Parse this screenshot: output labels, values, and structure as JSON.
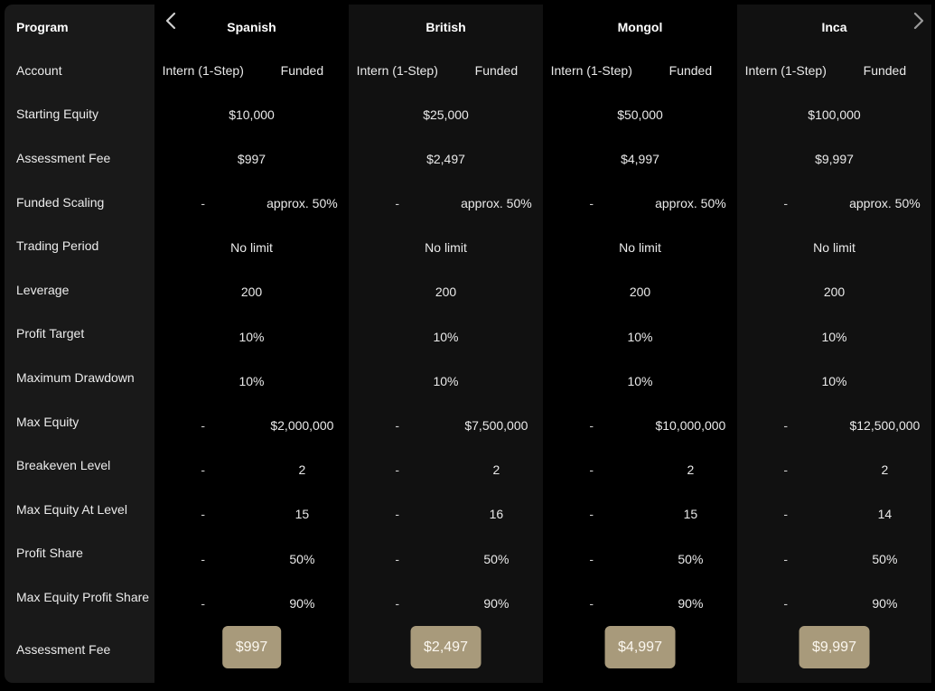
{
  "labels": {
    "program": "Program",
    "account": "Account",
    "starting_equity": "Starting Equity",
    "assessment_fee": "Assessment Fee",
    "funded_scaling": "Funded Scaling",
    "trading_period": "Trading Period",
    "leverage": "Leverage",
    "profit_target": "Profit Target",
    "maximum_drawdown": "Maximum Drawdown",
    "max_equity": "Max Equity",
    "breakeven_level": "Breakeven Level",
    "max_equity_at_level": "Max Equity At Level",
    "profit_share": "Profit Share",
    "max_equity_profit_share": "Max Equity Profit Share",
    "assessment_fee_bottom": "Assessment Fee"
  },
  "nav": {
    "prev_icon": "chevron-left-icon",
    "next_icon": "chevron-right-icon"
  },
  "programs": [
    {
      "name": "Spanish",
      "account_intern": "Intern (1-Step)",
      "account_funded": "Funded",
      "starting_equity": "$10,000",
      "assessment_fee": "$997",
      "funded_scaling_intern": "-",
      "funded_scaling_funded": "approx. 50%",
      "trading_period": "No limit",
      "leverage": "200",
      "profit_target": "10%",
      "maximum_drawdown": "10%",
      "max_equity_intern": "-",
      "max_equity_funded": "$2,000,000",
      "breakeven_intern": "-",
      "breakeven_funded": "2",
      "max_equity_level_intern": "-",
      "max_equity_level_funded": "15",
      "profit_share_intern": "-",
      "profit_share_funded": "50%",
      "max_equity_profit_share_intern": "-",
      "max_equity_profit_share_funded": "90%",
      "button_label": "$997"
    },
    {
      "name": "British",
      "account_intern": "Intern (1-Step)",
      "account_funded": "Funded",
      "starting_equity": "$25,000",
      "assessment_fee": "$2,497",
      "funded_scaling_intern": "-",
      "funded_scaling_funded": "approx. 50%",
      "trading_period": "No limit",
      "leverage": "200",
      "profit_target": "10%",
      "maximum_drawdown": "10%",
      "max_equity_intern": "-",
      "max_equity_funded": "$7,500,000",
      "breakeven_intern": "-",
      "breakeven_funded": "2",
      "max_equity_level_intern": "-",
      "max_equity_level_funded": "16",
      "profit_share_intern": "-",
      "profit_share_funded": "50%",
      "max_equity_profit_share_intern": "-",
      "max_equity_profit_share_funded": "90%",
      "button_label": "$2,497"
    },
    {
      "name": "Mongol",
      "account_intern": "Intern (1-Step)",
      "account_funded": "Funded",
      "starting_equity": "$50,000",
      "assessment_fee": "$4,997",
      "funded_scaling_intern": "-",
      "funded_scaling_funded": "approx. 50%",
      "trading_period": "No limit",
      "leverage": "200",
      "profit_target": "10%",
      "maximum_drawdown": "10%",
      "max_equity_intern": "-",
      "max_equity_funded": "$10,000,000",
      "breakeven_intern": "-",
      "breakeven_funded": "2",
      "max_equity_level_intern": "-",
      "max_equity_level_funded": "15",
      "profit_share_intern": "-",
      "profit_share_funded": "50%",
      "max_equity_profit_share_intern": "-",
      "max_equity_profit_share_funded": "90%",
      "button_label": "$4,997"
    },
    {
      "name": "Inca",
      "account_intern": "Intern (1-Step)",
      "account_funded": "Funded",
      "starting_equity": "$100,000",
      "assessment_fee": "$9,997",
      "funded_scaling_intern": "-",
      "funded_scaling_funded": "approx. 50%",
      "trading_period": "No limit",
      "leverage": "200",
      "profit_target": "10%",
      "maximum_drawdown": "10%",
      "max_equity_intern": "-",
      "max_equity_funded": "$12,500,000",
      "breakeven_intern": "-",
      "breakeven_funded": "2",
      "max_equity_level_intern": "-",
      "max_equity_level_funded": "14",
      "profit_share_intern": "-",
      "profit_share_funded": "50%",
      "max_equity_profit_share_intern": "-",
      "max_equity_profit_share_funded": "90%",
      "button_label": "$9,997"
    }
  ],
  "colors": {
    "button_bg": "#a89a7b",
    "label_panel_bg": "#191919",
    "column_alt_bg": "#111111"
  }
}
